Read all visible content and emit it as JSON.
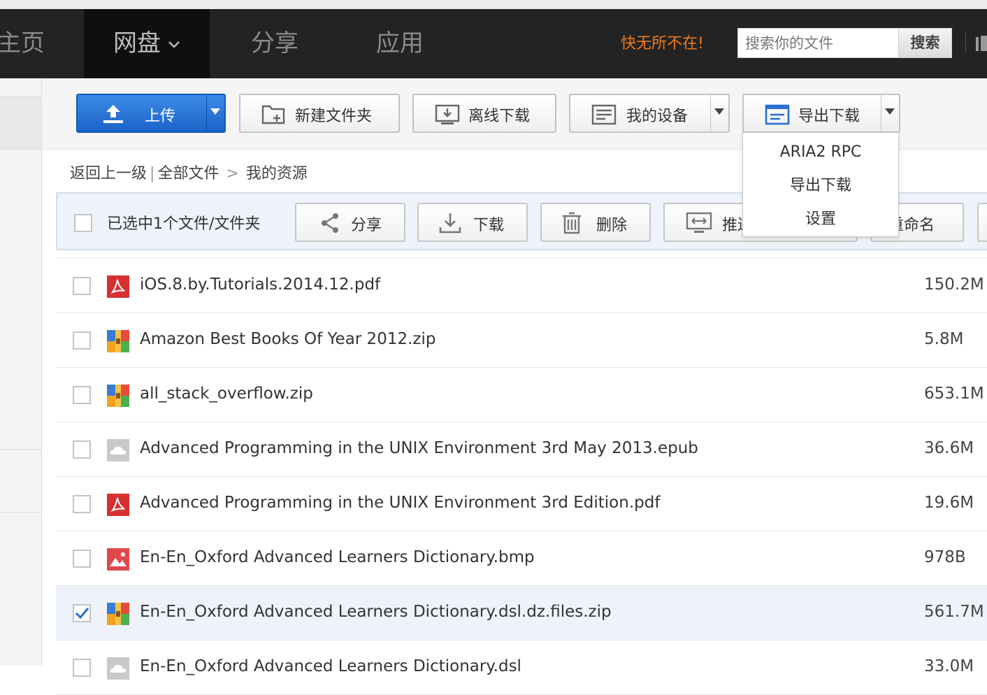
{
  "nav": {
    "home": "主页",
    "netdisk": "网盘",
    "share": "分享",
    "apps": "应用",
    "slogan": "快无所不在!",
    "search_placeholder": "搜索你的文件",
    "search_button": "搜索"
  },
  "toolbar": {
    "upload": "上传",
    "new_folder": "新建文件夹",
    "offline_download": "离线下载",
    "my_devices": "我的设备",
    "export_download": "导出下载"
  },
  "export_menu": {
    "items": [
      "ARIA2 RPC",
      "导出下载",
      "设置"
    ]
  },
  "breadcrumb": {
    "back": "返回上一级",
    "separator": "|",
    "all_files": "全部文件",
    "arrow": ">",
    "current": "我的资源"
  },
  "selection": {
    "text": "已选中1个文件/文件夹",
    "actions": {
      "share": "分享",
      "download": "下载",
      "delete": "删除",
      "push": "推送",
      "rename": "重命名"
    }
  },
  "files": [
    {
      "name": "iOS.8.by.Tutorials.2014.12.pdf",
      "size": "150.2M",
      "type": "pdf",
      "checked": false
    },
    {
      "name": "Amazon Best Books Of Year 2012.zip",
      "size": "5.8M",
      "type": "zip",
      "checked": false
    },
    {
      "name": "all_stack_overflow.zip",
      "size": "653.1M",
      "type": "zip",
      "checked": false
    },
    {
      "name": "Advanced Programming in the UNIX Environment 3rd May 2013.epub",
      "size": "36.6M",
      "type": "epub",
      "checked": false
    },
    {
      "name": "Advanced Programming in the UNIX Environment 3rd Edition.pdf",
      "size": "19.6M",
      "type": "pdf",
      "checked": false
    },
    {
      "name": "En-En_Oxford Advanced Learners Dictionary.bmp",
      "size": "978B",
      "type": "image",
      "checked": false
    },
    {
      "name": "En-En_Oxford Advanced Learners Dictionary.dsl.dz.files.zip",
      "size": "561.7M",
      "type": "zip",
      "checked": true
    },
    {
      "name": "En-En_Oxford Advanced Learners Dictionary.dsl",
      "size": "33.0M",
      "type": "epub",
      "checked": false
    }
  ],
  "colors": {
    "nav_bg": "#232323",
    "accent_blue": "#1a63c9",
    "slogan_orange": "#f07a1e",
    "selected_row": "#eef3fb",
    "check_blue": "#2a6fd0"
  }
}
